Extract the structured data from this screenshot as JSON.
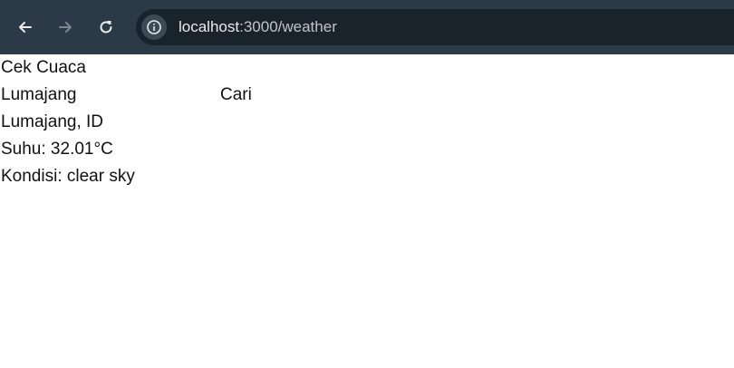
{
  "browser": {
    "url_host": "localhost",
    "url_rest": ":3000/weather",
    "icons": {
      "back": "back-arrow-icon",
      "forward": "forward-arrow-icon",
      "reload": "reload-icon",
      "info": "info-icon"
    },
    "colors": {
      "toolbar": "#2b3a46",
      "omnibox": "#18232c",
      "url_text": "#e8eaed",
      "forward_disabled": "#7b8791"
    }
  },
  "page": {
    "heading": "Cek Cuaca",
    "search": {
      "input_value": "Lumajang",
      "button_label": "Cari"
    },
    "result": {
      "location": "Lumajang, ID",
      "temperature": "Suhu: 32.01°C",
      "condition": "Kondisi: clear sky"
    }
  }
}
